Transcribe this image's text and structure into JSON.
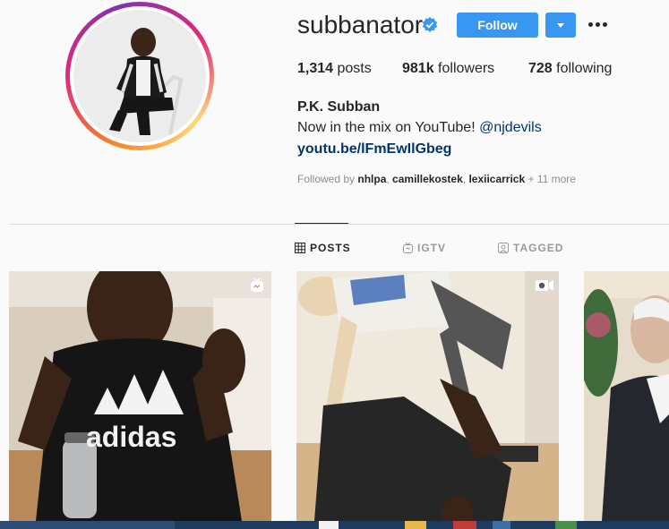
{
  "profile": {
    "username": "subbanator",
    "verified": true,
    "follow_label": "Follow",
    "posts_count": "1,314",
    "posts_label": "posts",
    "followers_count": "981k",
    "followers_label": "followers",
    "following_count": "728",
    "following_label": "following",
    "full_name": "P.K. Subban",
    "bio_text": "Now in the mix on YouTube! ",
    "bio_mention": "@njdevils",
    "link": "youtu.be/lFmEwIlGbeg",
    "followed_by_prefix": "Followed by ",
    "followed_by_users": [
      "nhlpa",
      "camillekostek",
      "lexiicarrick"
    ],
    "followed_by_more": " + 11 more"
  },
  "tabs": [
    {
      "label": "POSTS",
      "icon": "grid-icon",
      "active": true
    },
    {
      "label": "IGTV",
      "icon": "igtv-icon",
      "active": false
    },
    {
      "label": "TAGGED",
      "icon": "tag-icon",
      "active": false
    }
  ],
  "posts": [
    {
      "type": "igtv",
      "badge_icon": "igtv-badge-icon",
      "caption": "adidas"
    },
    {
      "type": "video",
      "badge_icon": "video-camera-icon"
    },
    {
      "type": "photo"
    }
  ],
  "colors": {
    "accent": "#3897f0",
    "link": "#003569",
    "background": "#fafafa"
  }
}
